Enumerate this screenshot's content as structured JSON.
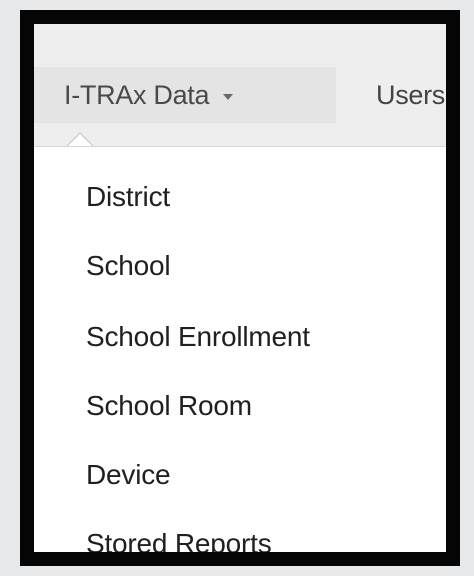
{
  "navbar": {
    "active_menu_label": "I-TRAx Data",
    "next_menu_label": "Users"
  },
  "dropdown": {
    "items": [
      {
        "label": "District"
      },
      {
        "label": "School"
      },
      {
        "label": "School Enrollment"
      },
      {
        "label": "School Room"
      },
      {
        "label": "Device"
      },
      {
        "label": "Stored Reports"
      }
    ]
  }
}
